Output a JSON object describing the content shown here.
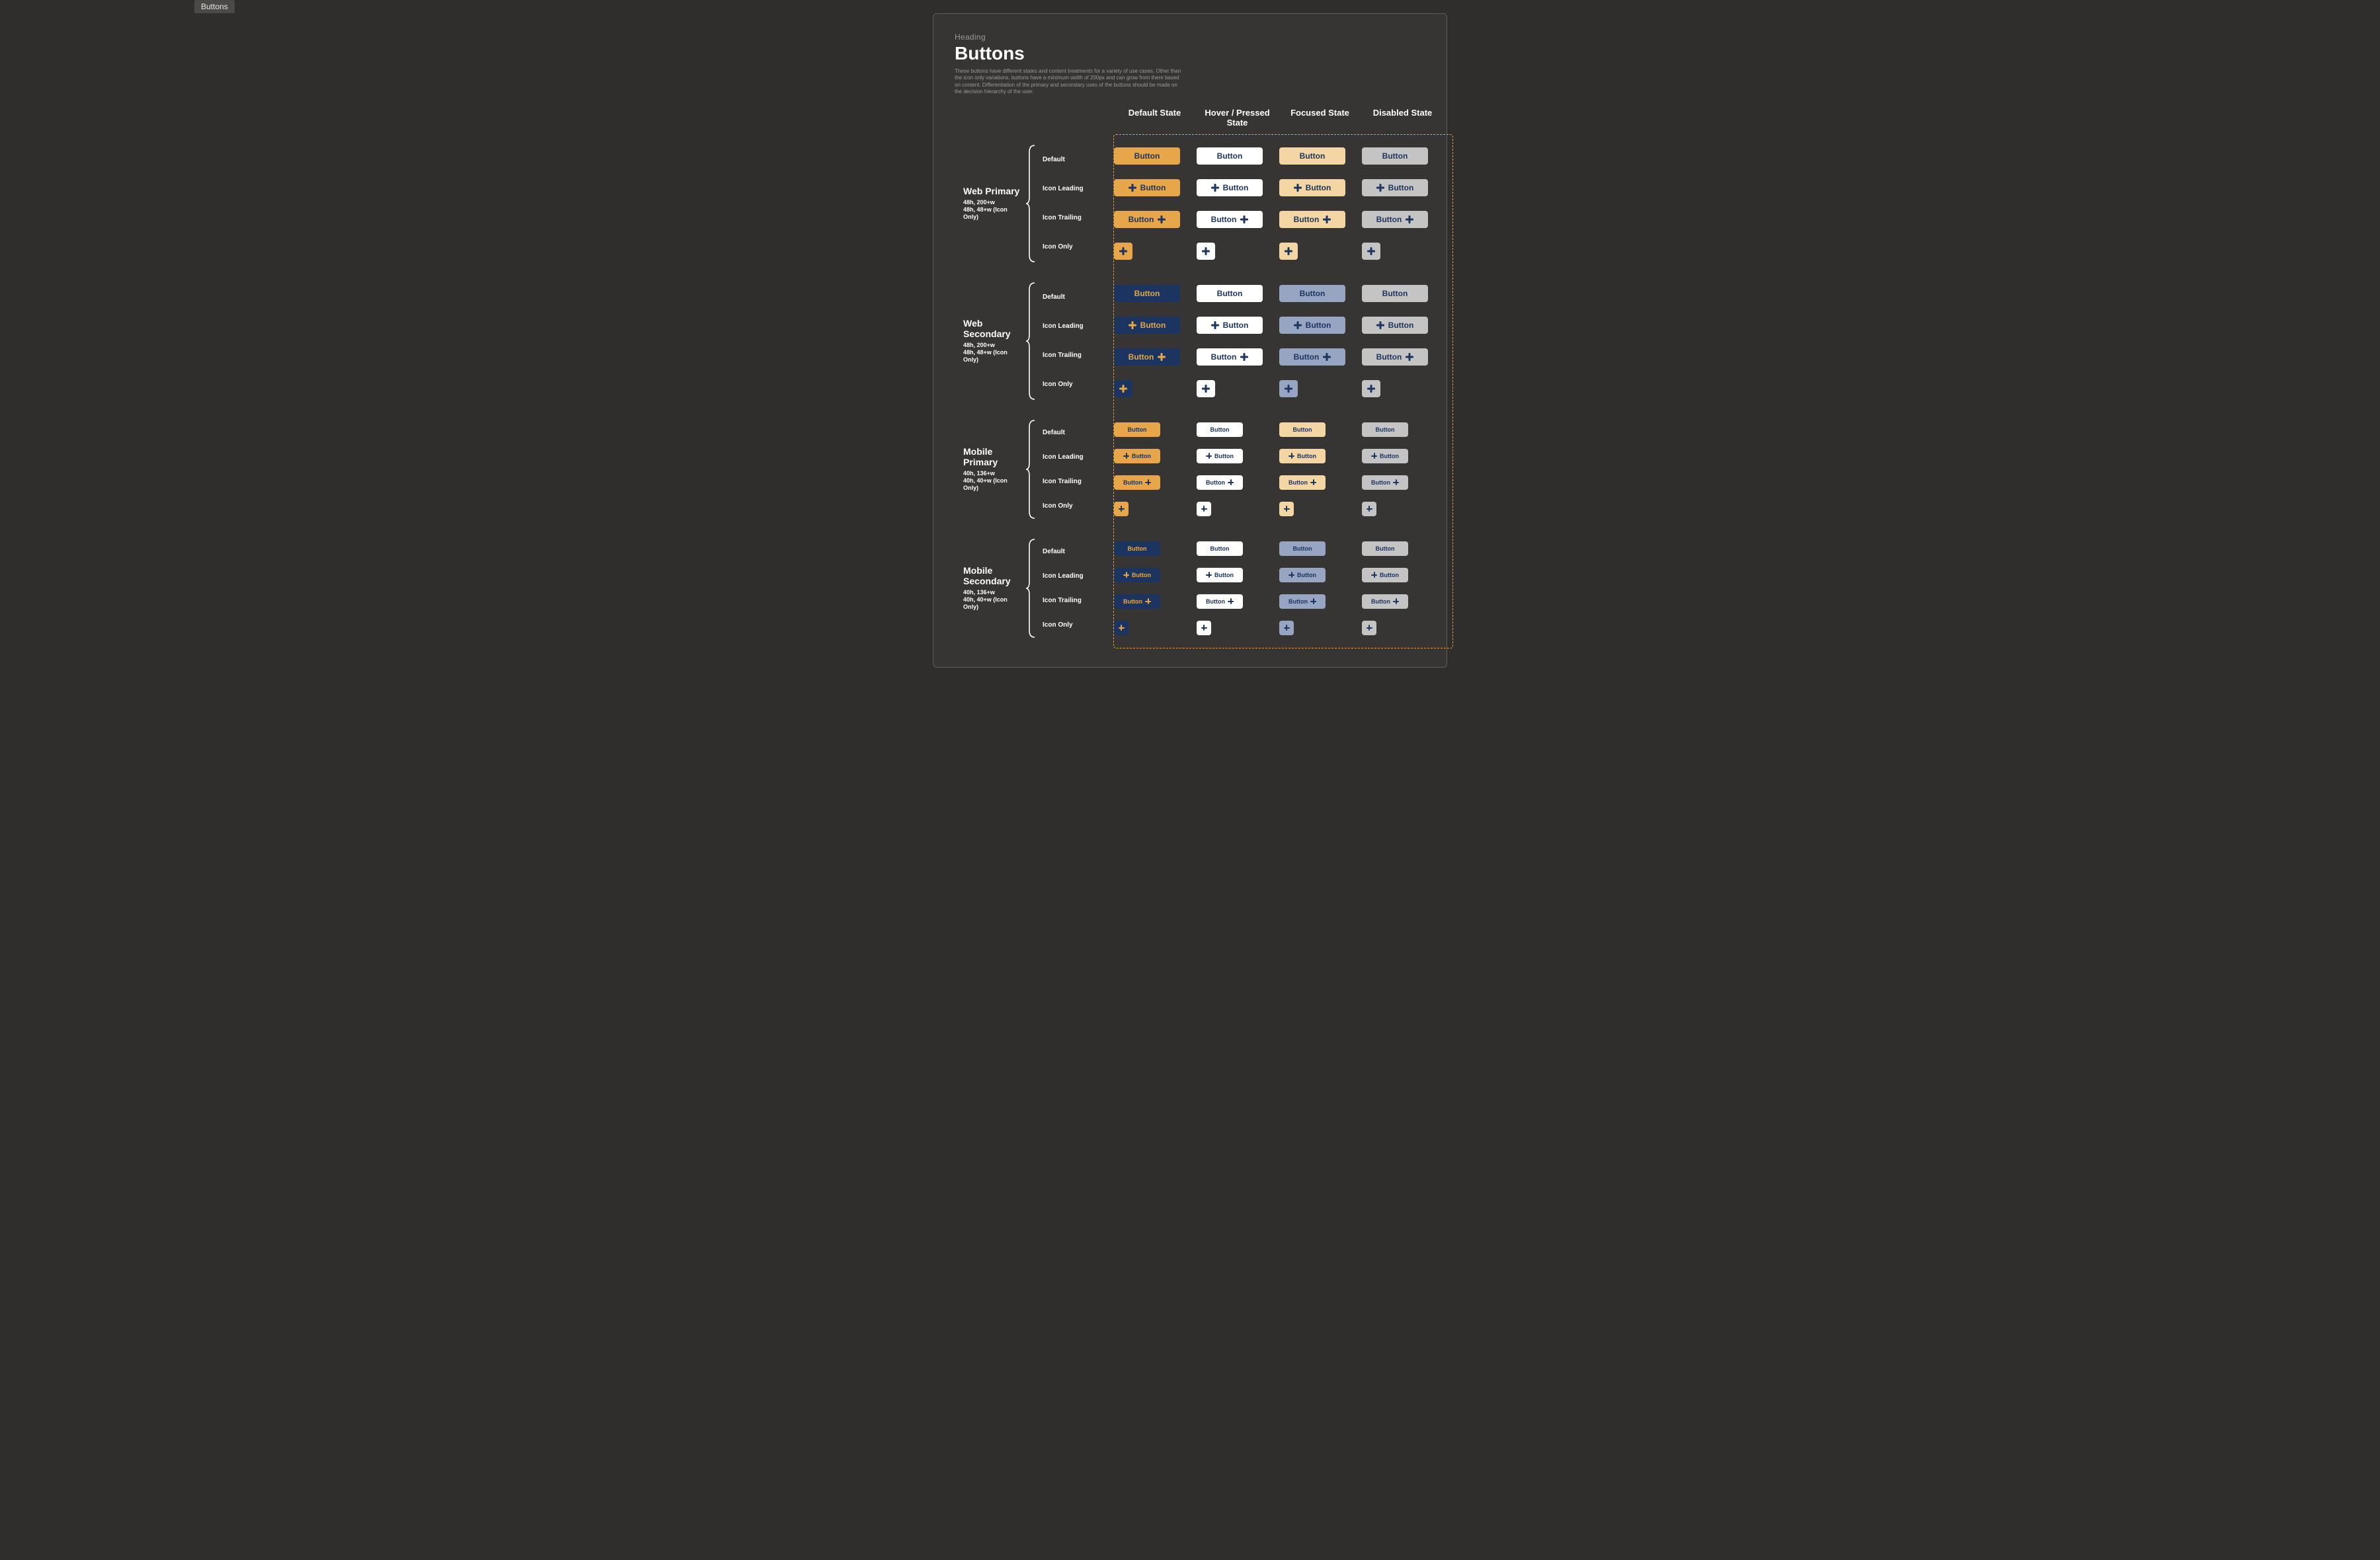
{
  "tab_label": "Buttons",
  "heading_label": "Heading",
  "title": "Buttons",
  "intro": "These buttons have different states and content treatments for a variety of use cases. Other than the icon only variations, buttons have a minimum width of 200px and can grow from there based on content. Differentiation of the primary and secondary uses of the buttons should be made on the decision hierarchy of the user.",
  "columns": [
    "Default State",
    "Hover / Pressed State",
    "Focused State",
    "Disabled State"
  ],
  "rows": [
    "Default",
    "Icon Leading",
    "Icon Trailing",
    "Icon Only"
  ],
  "button_label": "Button",
  "sections": [
    {
      "id": "web-primary",
      "name": "Web Primary",
      "meta1": "48h, 200+w",
      "meta2": "48h, 48+w (Icon Only)",
      "mobile": false,
      "palette": "primary"
    },
    {
      "id": "web-secondary",
      "name": "Web Secondary",
      "meta1": "48h, 200+w",
      "meta2": "48h, 48+w (Icon Only)",
      "mobile": false,
      "palette": "secondary"
    },
    {
      "id": "mobile-primary",
      "name": "Mobile Primary",
      "meta1": "40h, 136+w",
      "meta2": "40h, 40+w (Icon Only)",
      "mobile": true,
      "palette": "primary"
    },
    {
      "id": "mobile-secondary",
      "name": "Mobile Secondary",
      "meta1": "40h, 136+w",
      "meta2": "40h, 40+w (Icon Only)",
      "mobile": true,
      "palette": "secondary"
    }
  ],
  "palettes": {
    "primary": {
      "default": {
        "bg": "orange",
        "text": "navy"
      },
      "hover": {
        "bg": "white",
        "text": "navy"
      },
      "focused": {
        "bg": "orange-l",
        "text": "navy"
      },
      "disabled": {
        "bg": "gray",
        "text": "navy"
      }
    },
    "secondary": {
      "default": {
        "bg": "navy",
        "text": "orange"
      },
      "hover": {
        "bg": "white",
        "text": "navy"
      },
      "focused": {
        "bg": "bluegray",
        "text": "navy"
      },
      "disabled": {
        "bg": "gray",
        "text": "navy"
      }
    }
  },
  "colors": {
    "navy": "#1b3460",
    "orange": "#e6a649",
    "orange_light": "#f3d6a3",
    "white": "#ffffff",
    "gray": "#c4c4c4",
    "bluegray": "#97a5c3"
  }
}
